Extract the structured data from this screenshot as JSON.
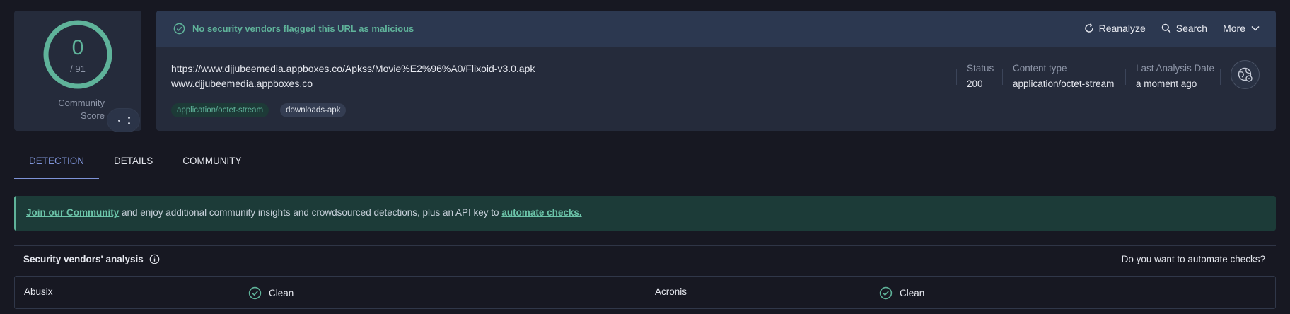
{
  "score": {
    "detections": "0",
    "total": "/ 91",
    "fraction": 0,
    "community_label_line1": "Community",
    "community_label_line2": "Score",
    "ring_color": "#5fb39a"
  },
  "banner": {
    "message": "No security vendors flagged this URL as malicious",
    "icon": "check-circle-icon",
    "actions": [
      {
        "label": "Reanalyze",
        "icon": "refresh-icon"
      },
      {
        "label": "Search",
        "icon": "search-icon"
      },
      {
        "label": "More",
        "icon": "chevron-down-icon"
      }
    ]
  },
  "target": {
    "url": "https://www.djjubeemedia.appboxes.co/Apkss/Movie%E2%96%A0/Flixoid-v3.0.apk",
    "domain": "www.djjubeemedia.appboxes.co",
    "tags": [
      "application/octet-stream",
      "downloads-apk"
    ]
  },
  "meta": {
    "status_label": "Status",
    "status_value": "200",
    "content_type_label": "Content type",
    "content_type_value": "application/octet-stream",
    "last_analysis_label": "Last Analysis Date",
    "last_analysis_value": "a moment ago"
  },
  "tabs": [
    {
      "label": "DETECTION",
      "active": true
    },
    {
      "label": "DETAILS",
      "active": false
    },
    {
      "label": "COMMUNITY",
      "active": false
    }
  ],
  "invite": {
    "link1": "Join our Community",
    "middle": " and enjoy additional community insights and crowdsourced detections, plus an API key to ",
    "link2": "automate checks."
  },
  "vendors": {
    "title": "Security vendors' analysis",
    "automate": "Do you want to automate checks?",
    "rows": [
      {
        "name_a": "Abusix",
        "result_a": "Clean",
        "name_b": "Acronis",
        "result_b": "Clean"
      }
    ]
  },
  "colors": {
    "accent": "#7e93d7",
    "clean": "#5fb39a",
    "background": "#171822",
    "card": "#252b3b"
  }
}
